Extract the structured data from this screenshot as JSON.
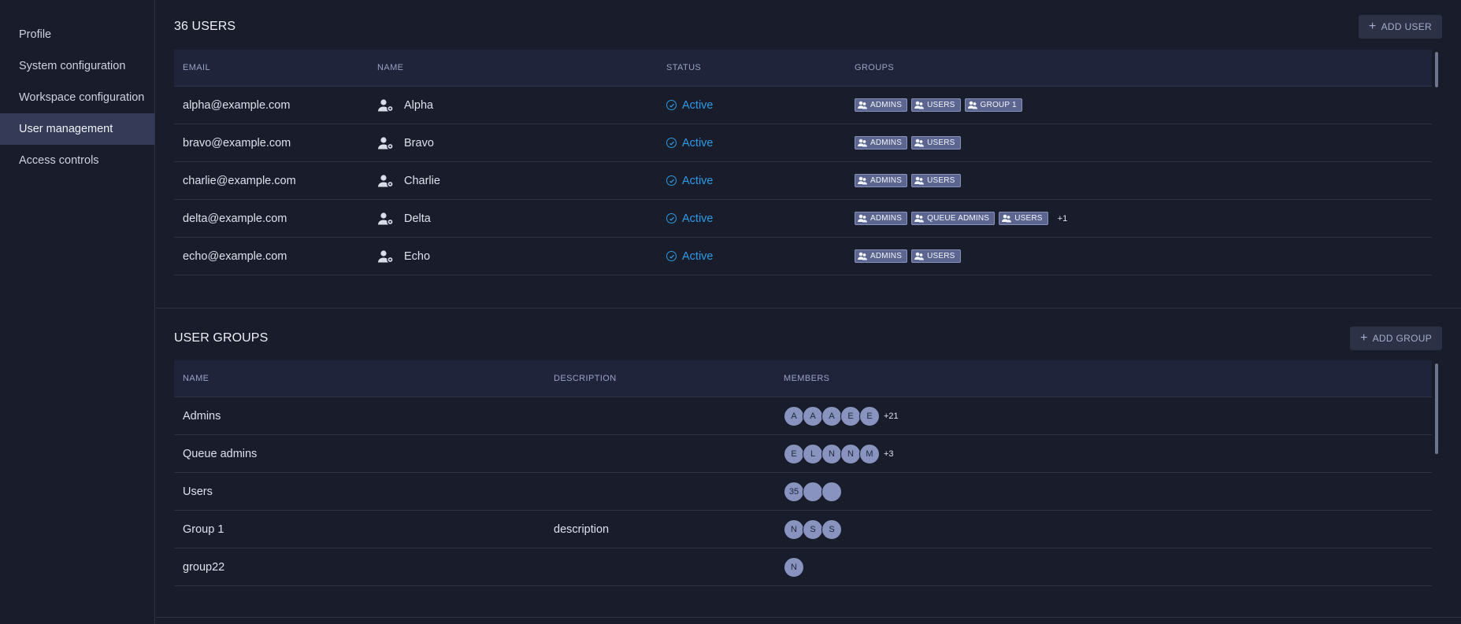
{
  "sidebar": {
    "items": [
      {
        "label": "Profile"
      },
      {
        "label": "System configuration"
      },
      {
        "label": "Workspace configuration"
      },
      {
        "label": "User management",
        "active": true
      },
      {
        "label": "Access controls"
      }
    ]
  },
  "users": {
    "title": "36 USERS",
    "add_label": "ADD USER",
    "columns": [
      "EMAIL",
      "NAME",
      "STATUS",
      "GROUPS"
    ],
    "rows": [
      {
        "email": "alpha@example.com",
        "name": "Alpha",
        "status": "Active",
        "groups": [
          "ADMINS",
          "USERS",
          "GROUP 1"
        ],
        "more": ""
      },
      {
        "email": "bravo@example.com",
        "name": "Bravo",
        "status": "Active",
        "groups": [
          "ADMINS",
          "USERS"
        ],
        "more": ""
      },
      {
        "email": "charlie@example.com",
        "name": "Charlie",
        "status": "Active",
        "groups": [
          "ADMINS",
          "USERS"
        ],
        "more": ""
      },
      {
        "email": "delta@example.com",
        "name": "Delta",
        "status": "Active",
        "groups": [
          "ADMINS",
          "QUEUE ADMINS",
          "USERS"
        ],
        "more": "+1"
      },
      {
        "email": "echo@example.com",
        "name": "Echo",
        "status": "Active",
        "groups": [
          "ADMINS",
          "USERS"
        ],
        "more": ""
      }
    ]
  },
  "groups": {
    "title": "USER GROUPS",
    "add_label": "ADD GROUP",
    "columns": [
      "NAME",
      "DESCRIPTION",
      "MEMBERS"
    ],
    "rows": [
      {
        "name": "Admins",
        "description": "",
        "members": [
          "A",
          "A",
          "A",
          "E",
          "E"
        ],
        "more": "+21"
      },
      {
        "name": "Queue admins",
        "description": "",
        "members": [
          "E",
          "L",
          "N",
          "N",
          "M"
        ],
        "more": "+3"
      },
      {
        "name": "Users",
        "description": "",
        "members": [
          "35",
          "",
          ""
        ],
        "more": ""
      },
      {
        "name": "Group 1",
        "description": "description",
        "members": [
          "N",
          "S",
          "S"
        ],
        "more": ""
      },
      {
        "name": "group22",
        "description": "",
        "members": [
          "N"
        ],
        "more": ""
      }
    ]
  },
  "colors": {
    "background": "#191c2b",
    "active_nav": "#353b57",
    "status_active": "#2f9be4",
    "tag": "#5b6590",
    "avatar": "#8893bf"
  },
  "icons": {
    "user_row": "user-gear-icon",
    "status": "check-circle-icon",
    "tag": "group-icon",
    "add": "plus-icon"
  }
}
